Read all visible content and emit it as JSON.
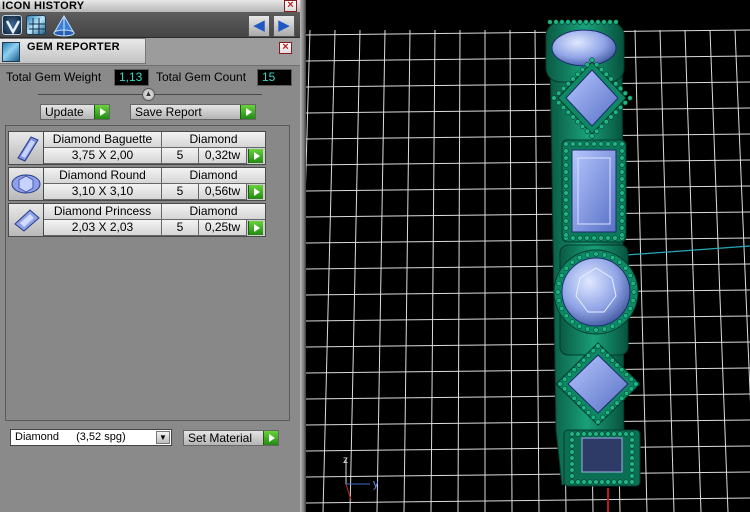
{
  "icon_history": {
    "title": "ICON HISTORY",
    "icons": [
      "v-logo-icon",
      "gem-grid-icon",
      "cone-mesh-icon"
    ],
    "nav": {
      "back": "back-arrow-icon",
      "forward": "forward-arrow-icon"
    }
  },
  "gem_reporter": {
    "title": "GEM REPORTER",
    "total_weight_label": "Total Gem Weight",
    "total_weight_value": "1,13",
    "total_count_label": "Total Gem Count",
    "total_count_value": "15",
    "update_label": "Update",
    "save_label": "Save Report",
    "gems": [
      {
        "name": "Diamond Baguette",
        "material": "Diamond",
        "size": "3,75 X 2,00",
        "count": "5",
        "weight": "0,32tw",
        "icon": "baguette-gem-icon"
      },
      {
        "name": "Diamond Round",
        "material": "Diamond",
        "size": "3,10 X 3,10",
        "count": "5",
        "weight": "0,56tw",
        "icon": "round-gem-icon"
      },
      {
        "name": "Diamond Princess",
        "material": "Diamond",
        "size": "2,03 X 2,03",
        "count": "5",
        "weight": "0,25tw",
        "icon": "princess-gem-icon"
      }
    ],
    "material_select": {
      "name": "Diamond",
      "spg": "(3,52 spg)"
    },
    "set_material_label": "Set Material"
  },
  "viewport": {
    "axis_labels": {
      "z": "z",
      "y": "y"
    },
    "colors": {
      "background": "#000000",
      "grid": "#e6e6e6",
      "metal": "#0d7a5a",
      "gem": "#8fa6e8"
    }
  }
}
